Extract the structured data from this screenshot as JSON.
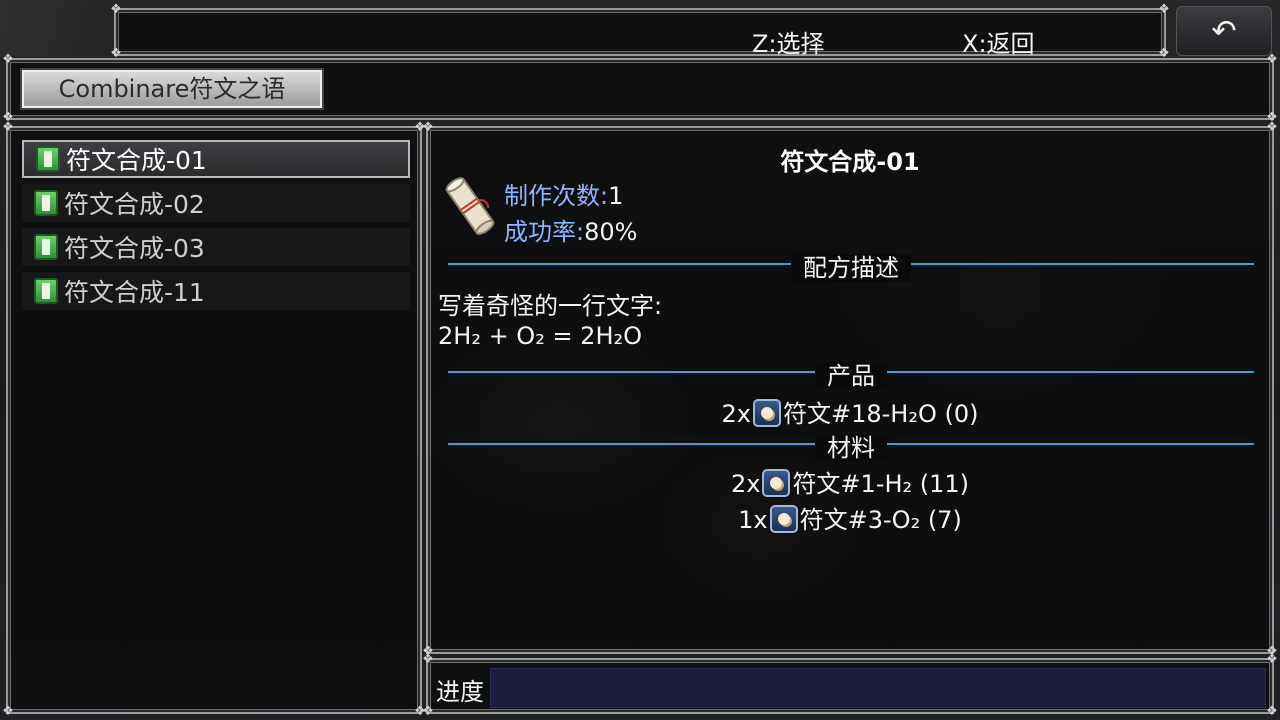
{
  "controls": {
    "select_hint": "Z:选择",
    "back_hint": "X:返回",
    "back_icon": "↶"
  },
  "header": {
    "title": "Combinare符文之语"
  },
  "recipes": [
    {
      "label": "符文合成-01",
      "selected": true
    },
    {
      "label": "符文合成-02",
      "selected": false
    },
    {
      "label": "符文合成-03",
      "selected": false
    },
    {
      "label": "符文合成-11",
      "selected": false
    }
  ],
  "detail": {
    "title": "符文合成-01",
    "craft_count_label": "制作次数:",
    "craft_count_value": "1",
    "success_rate_label": "成功率:",
    "success_rate_value": "80%",
    "description_header": "配方描述",
    "description_lines": [
      "写着奇怪的一行文字:",
      "2H₂ + O₂ = 2H₂O"
    ],
    "product_header": "产品",
    "products": [
      {
        "qty": "2x",
        "name": "符文#18-H₂O (0)"
      }
    ],
    "materials_header": "材料",
    "materials": [
      {
        "qty": "2x",
        "name": "符文#1-H₂ (11)"
      },
      {
        "qty": "1x",
        "name": "符文#3-O₂ (7)"
      }
    ]
  },
  "progress": {
    "label": "进度",
    "value": 0
  },
  "colors": {
    "stat_label": "#8fb4ff",
    "section_rule": "#3fa0d6",
    "progress_track": "#1c1d3b"
  }
}
